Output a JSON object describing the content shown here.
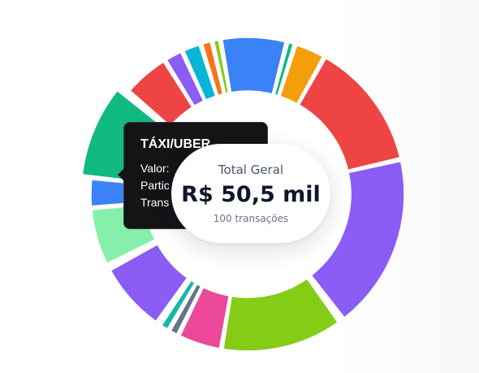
{
  "chart_data": {
    "type": "pie",
    "title": "",
    "slices": [
      {
        "value": 12.6,
        "color": "#3b82f6"
      },
      {
        "value": 1.6,
        "color": "#10b981"
      },
      {
        "value": 6.0,
        "color": "#f59e0b"
      },
      {
        "value": 24.6,
        "color": "#ef4444"
      },
      {
        "value": 33.6,
        "color": "#8b5cf6"
      },
      {
        "value": 0.8,
        "color": "#14b8a6"
      },
      {
        "value": 23.4,
        "color": "#84cc16"
      },
      {
        "value": 8.5,
        "color": "#ec4899"
      },
      {
        "value": 2.0,
        "color": "#64748b"
      },
      {
        "value": 2.0,
        "color": "#14b8a6"
      },
      {
        "value": 0.6,
        "color": "#f3f4f6"
      },
      {
        "value": 13.6,
        "color": "#8b5cf6"
      },
      {
        "value": 0.8,
        "color": "#ef4444"
      },
      {
        "value": 11.2,
        "color": "#86efac"
      },
      {
        "value": 5.7,
        "color": "#3b82f6"
      },
      {
        "value": 17.0,
        "color": "#10b981"
      },
      {
        "value": 0.8,
        "color": "#f59e0b"
      },
      {
        "value": 9.0,
        "color": "#ef4444"
      },
      {
        "value": 3.7,
        "color": "#8b5cf6"
      },
      {
        "value": 3.7,
        "color": "#06b6d4"
      },
      {
        "value": 2.2,
        "color": "#f97316"
      },
      {
        "value": 1.6,
        "color": "#84cc16"
      }
    ],
    "highlighted_index": 15
  },
  "tooltip": {
    "title": "TÁXI/UBER",
    "line1": "Valor:",
    "line2": "Partic",
    "line3": "Trans"
  },
  "center": {
    "label": "Total Geral",
    "value": "R$ 50,5 mil",
    "subtitle": "100 transações"
  }
}
